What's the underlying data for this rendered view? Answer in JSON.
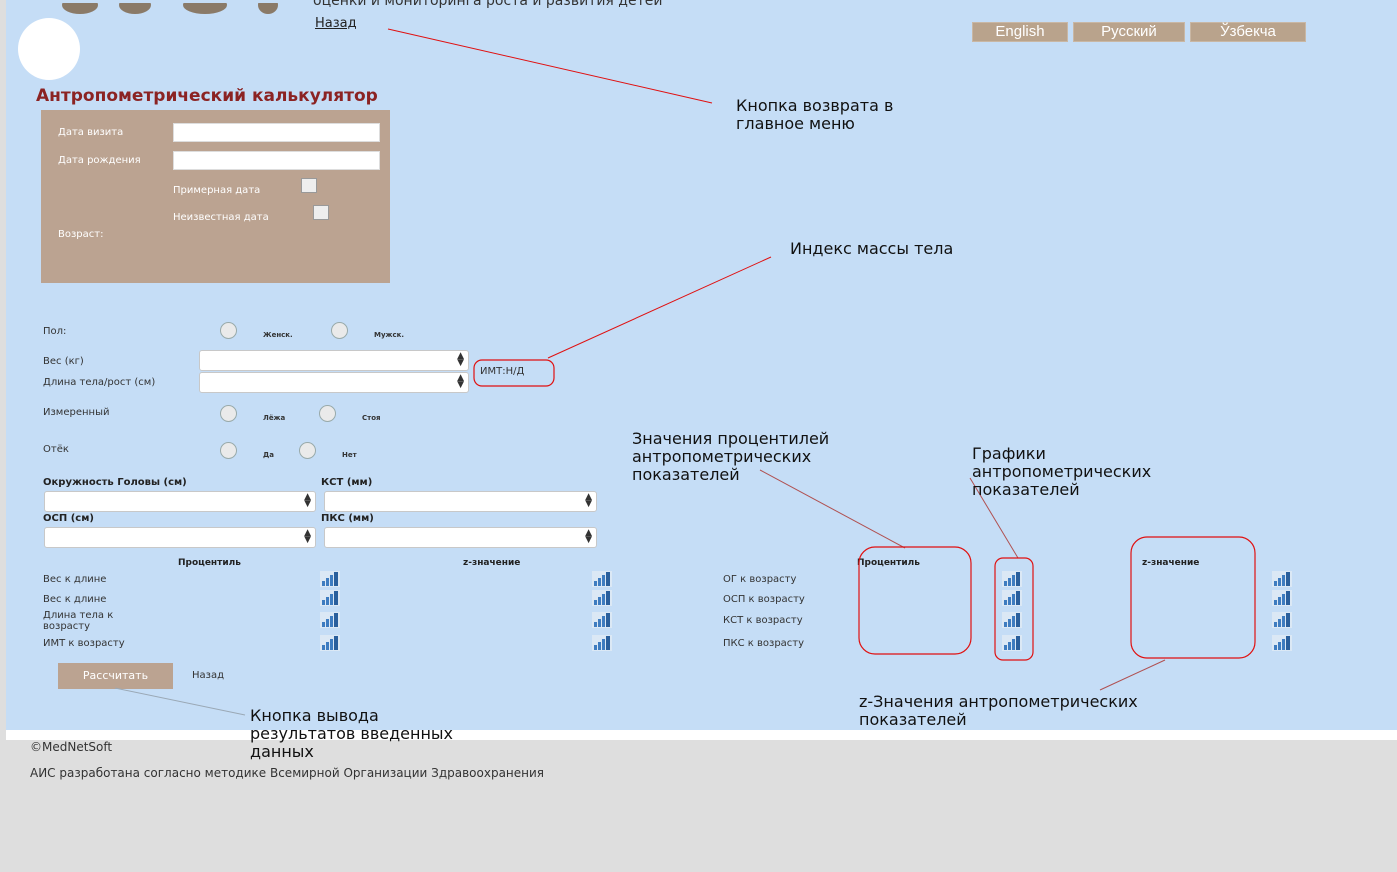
{
  "header": {
    "subtitle": "оценки и мониторинга роста и развития детей",
    "back_link": "Назад",
    "languages": [
      "English",
      "Русский",
      "Ўзбекча"
    ]
  },
  "page_title": "Антропометрический калькулятор",
  "visit_card": {
    "visit_date_label": "Дата визита",
    "visit_date_value": "",
    "birth_date_label": "Дата рождения",
    "birth_date_value": "",
    "approx_date_label": "Примерная дата",
    "unknown_date_label": "Неизвестная дата",
    "age_label": "Возраст:"
  },
  "form": {
    "sex_label": "Пол:",
    "sex_female": "Женск.",
    "sex_male": "Мужск.",
    "weight_label": "Вес (кг)",
    "length_label": "Длина тела/рост (см)",
    "bmi_text": "ИМТ:Н/Д",
    "measured_label": "Измеренный",
    "measured_lying": "Лёжа",
    "measured_standing": "Стоя",
    "edema_label": "Отёк",
    "edema_yes": "Да",
    "edema_no": "Нет",
    "head_circ_label": "Окружность Головы (см)",
    "kst_label": "КСТ (мм)",
    "osp_label": "ОСП (см)",
    "pks_label": "ПКС (мм)"
  },
  "results": {
    "percentile_header": "Процентиль",
    "zscore_header": "z-значение",
    "left_rows": [
      "Вес к длине",
      "Вес к длине",
      "Длина тела к возрасту",
      "ИМТ к возрасту"
    ],
    "right_rows": [
      "ОГ к возрасту",
      "ОСП к возрасту",
      "КСТ к возрасту",
      "ПКС к возрасту"
    ],
    "right_percentile_header": "Процентиль",
    "right_zscore_header": "z-значение"
  },
  "buttons": {
    "calculate": "Рассчитать",
    "back": "Назад"
  },
  "annotations": {
    "back_button": [
      "Кнопка возврата в",
      "главное меню"
    ],
    "bmi": "Индекс массы тела",
    "percentiles": [
      "Значения процентилей",
      "антропометрических",
      "показателей"
    ],
    "charts": [
      "Графики",
      "антропометрических",
      "показателей"
    ],
    "zscores": [
      "z-Значения антропометрических",
      "показателей"
    ],
    "calc_button": [
      "Кнопка вывода",
      "результатов введенных",
      "данных"
    ]
  },
  "footer": {
    "copyright": "©MedNetSoft",
    "note": "АИС разработана согласно методике Всемирной Организации Здравоохранения"
  },
  "colors": {
    "main_bg": "#c5ddf6",
    "card_bg": "#bba391",
    "title": "#8b2323",
    "annotation_red": "#e01010"
  }
}
